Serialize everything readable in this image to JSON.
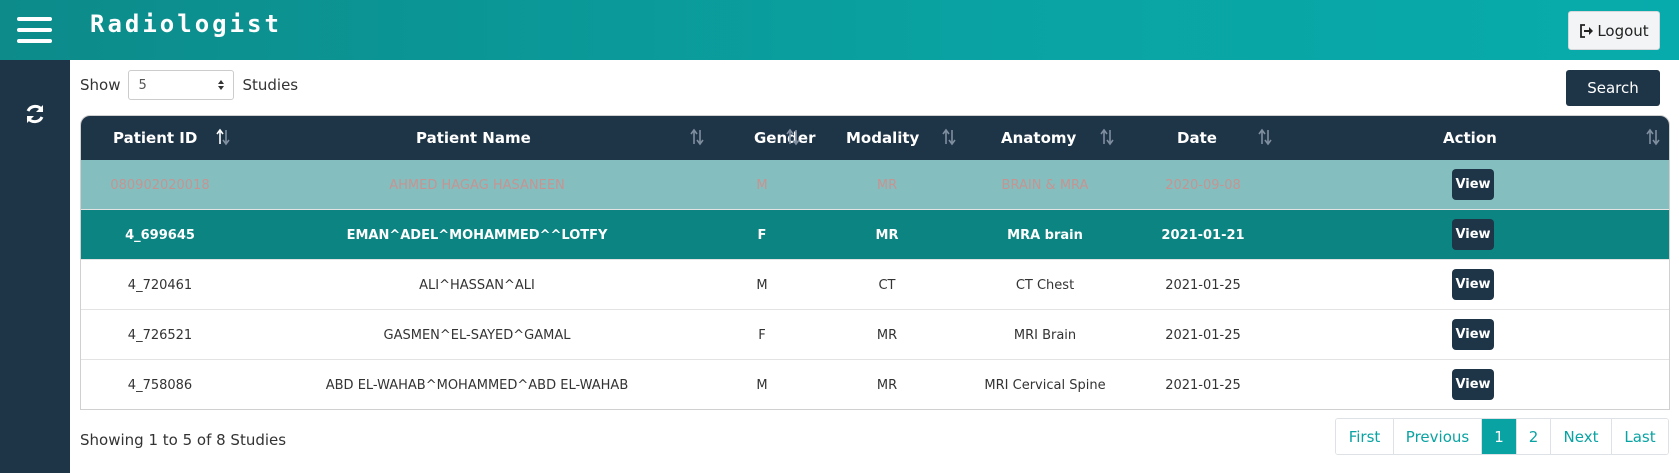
{
  "header": {
    "title": "Radiologist",
    "logout_label": "Logout"
  },
  "controls": {
    "show_label": "Show",
    "page_size": "5",
    "studies_label": "Studies",
    "search_label": "Search"
  },
  "table": {
    "columns": [
      "Patient ID",
      "Patient Name",
      "Gender",
      "Modality",
      "Anatomy",
      "Date",
      "Action"
    ],
    "rows": [
      {
        "patient_id": "080902020018",
        "patient_name": "AHMED HAGAG HASANEEN",
        "gender": "M",
        "modality": "MR",
        "anatomy": "BRAIN & MRA",
        "date": "2020-09-08",
        "action": "View",
        "state": "faded"
      },
      {
        "patient_id": "4_699645",
        "patient_name": "EMAN^ADEL^MOHAMMED^^LOTFY",
        "gender": "F",
        "modality": "MR",
        "anatomy": "MRA brain",
        "date": "2021-01-21",
        "action": "View",
        "state": "selected"
      },
      {
        "patient_id": "4_720461",
        "patient_name": "ALI^HASSAN^ALI",
        "gender": "M",
        "modality": "CT",
        "anatomy": "CT Chest",
        "date": "2021-01-25",
        "action": "View",
        "state": "plain"
      },
      {
        "patient_id": "4_726521",
        "patient_name": "GASMEN^EL-SAYED^GAMAL",
        "gender": "F",
        "modality": "MR",
        "anatomy": "MRI Brain",
        "date": "2021-01-25",
        "action": "View",
        "state": "plain"
      },
      {
        "patient_id": "4_758086",
        "patient_name": "ABD EL-WAHAB^MOHAMMED^ABD EL-WAHAB",
        "gender": "M",
        "modality": "MR",
        "anatomy": "MRI Cervical Spine",
        "date": "2021-01-25",
        "action": "View",
        "state": "plain"
      }
    ]
  },
  "footer": {
    "info": "Showing 1 to 5 of 8 Studies"
  },
  "pagination": {
    "first": "First",
    "previous": "Previous",
    "pages": [
      "1",
      "2"
    ],
    "active_page": "1",
    "next": "Next",
    "last": "Last"
  },
  "icons": {
    "menu": "hamburger-menu-icon",
    "refresh": "refresh-icon",
    "logout": "sign-out-icon",
    "sort": "sort-arrows-icon",
    "select": "select-caret-icon"
  },
  "colors": {
    "header_gradient_start": "#0c8b8a",
    "header_gradient_end": "#08abab",
    "dark_navy": "#1e3447",
    "selected_row": "#0b8482",
    "faded_row": "#84bebf",
    "accent": "#0aa3a3"
  }
}
